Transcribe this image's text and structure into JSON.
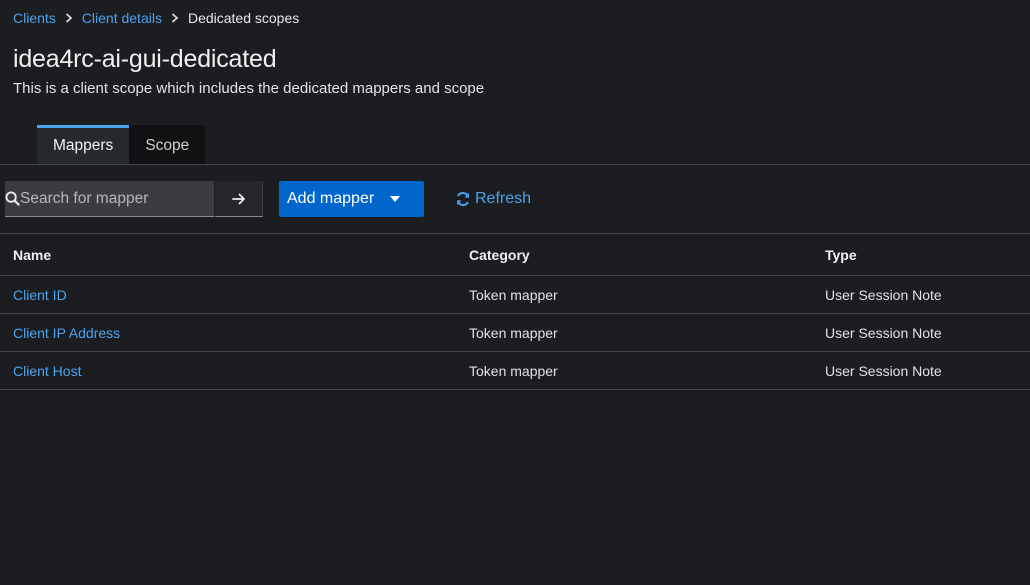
{
  "breadcrumb": {
    "items": [
      {
        "label": "Clients"
      },
      {
        "label": "Client details"
      },
      {
        "label": "Dedicated scopes"
      }
    ]
  },
  "header": {
    "title": "idea4rc-ai-gui-dedicated",
    "subtitle": "This is a client scope which includes the dedicated mappers and scope"
  },
  "tabs": [
    {
      "label": "Mappers",
      "active": true
    },
    {
      "label": "Scope",
      "active": false
    }
  ],
  "toolbar": {
    "search_placeholder": "Search for mapper",
    "search_value": "",
    "add_mapper_label": "Add mapper",
    "refresh_label": "Refresh"
  },
  "table": {
    "columns": [
      "Name",
      "Category",
      "Type"
    ],
    "rows": [
      {
        "name": "Client ID",
        "category": "Token mapper",
        "type": "User Session Note"
      },
      {
        "name": "Client IP Address",
        "category": "Token mapper",
        "type": "User Session Note"
      },
      {
        "name": "Client Host",
        "category": "Token mapper",
        "type": "User Session Note"
      }
    ]
  },
  "colors": {
    "background": "#1b1d21",
    "link": "#4ba3ee",
    "primary_button": "#0066cc"
  },
  "icons": [
    "chevron-right-icon",
    "search-icon",
    "arrow-right-icon",
    "caret-down-icon",
    "refresh-icon"
  ]
}
